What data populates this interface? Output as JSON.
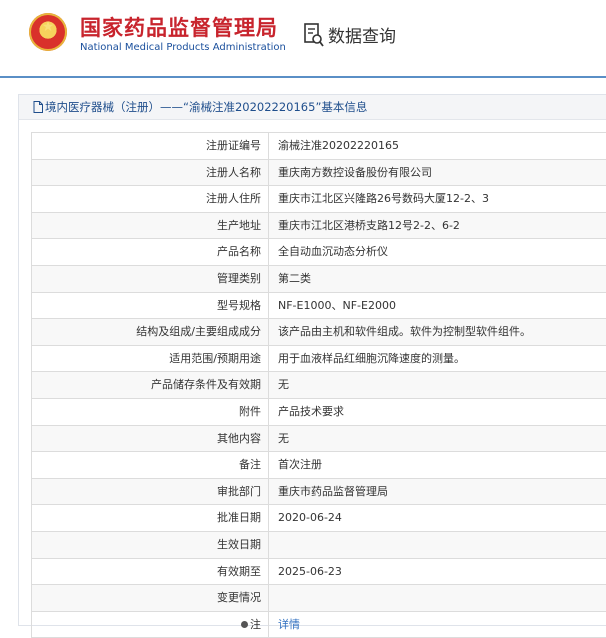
{
  "header": {
    "title_cn": "国家药品监督管理局",
    "title_en": "National Medical Products Administration",
    "query_label": "数据查询",
    "query_icon": "document-search-icon",
    "emblem_icon": "national-emblem-icon"
  },
  "panel": {
    "breadcrumb": "境内医疗器械（注册）——“渝械注准20202220165”基本信息"
  },
  "rows": [
    {
      "label": "注册证编号",
      "value": "渝械注准20202220165"
    },
    {
      "label": "注册人名称",
      "value": "重庆南方数控设备股份有限公司"
    },
    {
      "label": "注册人住所",
      "value": "重庆市江北区兴隆路26号数码大厦12-2、3"
    },
    {
      "label": "生产地址",
      "value": "重庆市江北区港桥支路12号2-2、6-2"
    },
    {
      "label": "产品名称",
      "value": "全自动血沉动态分析仪"
    },
    {
      "label": "管理类别",
      "value": "第二类"
    },
    {
      "label": "型号规格",
      "value": "NF-E1000、NF-E2000"
    },
    {
      "label": "结构及组成/主要组成成分",
      "value": "该产品由主机和软件组成。软件为控制型软件组件。"
    },
    {
      "label": "适用范围/预期用途",
      "value": "用于血液样品红细胞沉降速度的测量。"
    },
    {
      "label": "产品储存条件及有效期",
      "value": "无"
    },
    {
      "label": "附件",
      "value": "产品技术要求"
    },
    {
      "label": "其他内容",
      "value": "无"
    },
    {
      "label": "备注",
      "value": "首次注册"
    },
    {
      "label": "审批部门",
      "value": "重庆市药品监督管理局"
    },
    {
      "label": "批准日期",
      "value": "2020-06-24"
    },
    {
      "label": "生效日期",
      "value": ""
    },
    {
      "label": "有效期至",
      "value": "2025-06-23"
    },
    {
      "label": "变更情况",
      "value": ""
    },
    {
      "label": "注",
      "value": "详情"
    }
  ]
}
